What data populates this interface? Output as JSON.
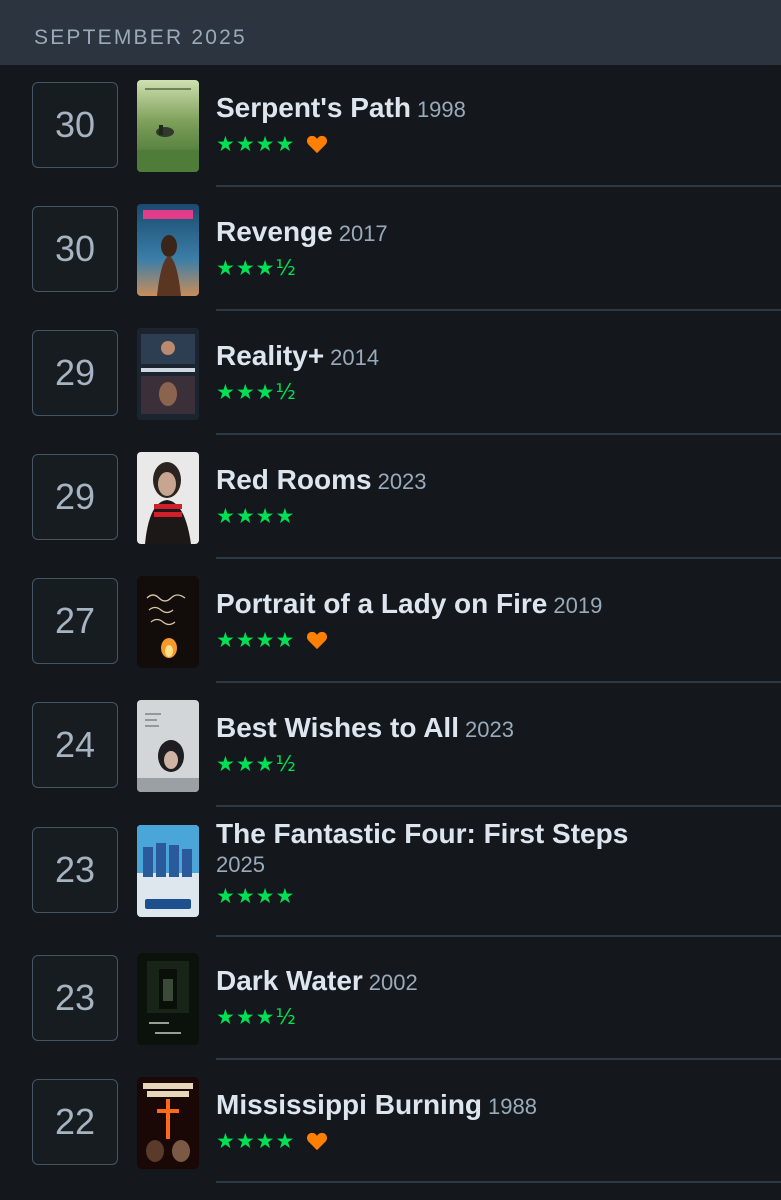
{
  "header": {
    "month": "SEPTEMBER 2025"
  },
  "entries": [
    {
      "day": "30",
      "title": "Serpent's Path",
      "year": "1998",
      "stars": "★★★★",
      "liked": true,
      "poster": "serpents-path-poster"
    },
    {
      "day": "30",
      "title": "Revenge",
      "year": "2017",
      "stars": "★★★½",
      "liked": false,
      "poster": "revenge-poster"
    },
    {
      "day": "29",
      "title": "Reality+",
      "year": "2014",
      "stars": "★★★½",
      "liked": false,
      "poster": "reality-plus-poster"
    },
    {
      "day": "29",
      "title": "Red Rooms",
      "year": "2023",
      "stars": "★★★★",
      "liked": false,
      "poster": "red-rooms-poster"
    },
    {
      "day": "27",
      "title": "Portrait of a Lady on Fire",
      "year": "2019",
      "stars": "★★★★",
      "liked": true,
      "poster": "portrait-lady-fire-poster"
    },
    {
      "day": "24",
      "title": "Best Wishes to All",
      "year": "2023",
      "stars": "★★★½",
      "liked": false,
      "poster": "best-wishes-poster"
    },
    {
      "day": "23",
      "title": "The Fantastic Four: First Steps",
      "year": "2025",
      "stars": "★★★★",
      "liked": false,
      "poster": "fantastic-four-poster"
    },
    {
      "day": "23",
      "title": "Dark Water",
      "year": "2002",
      "stars": "★★★½",
      "liked": false,
      "poster": "dark-water-poster"
    },
    {
      "day": "22",
      "title": "Mississippi Burning",
      "year": "1988",
      "stars": "★★★★",
      "liked": true,
      "poster": "mississippi-burning-poster"
    }
  ],
  "colors": {
    "header_bg": "#2c3440",
    "page_bg": "#14181c",
    "star_green": "#00e054",
    "heart_orange": "#ff8000"
  }
}
